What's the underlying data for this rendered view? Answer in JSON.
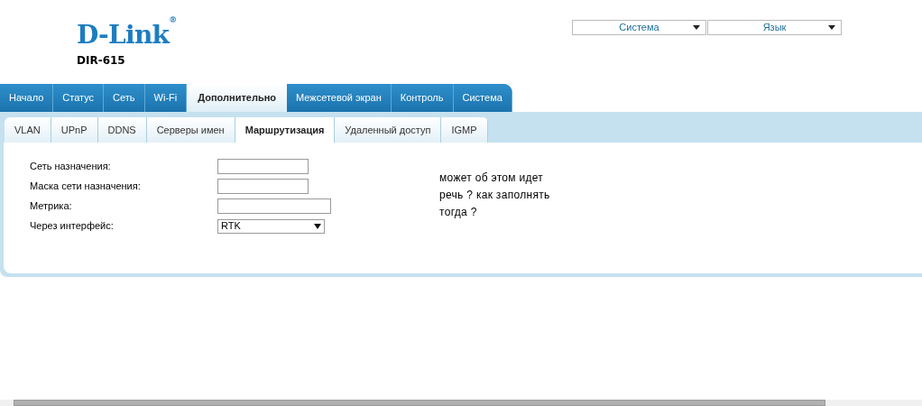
{
  "header": {
    "logo": "D-Link$^{®}$",
    "model": "DIR-615",
    "menus": [
      {
        "label": "Система"
      },
      {
        "label": "Язык"
      }
    ]
  },
  "main_tabs": [
    {
      "label": "Начало",
      "selected": false
    },
    {
      "label": "Статус",
      "selected": false
    },
    {
      "label": "Сеть",
      "selected": false
    },
    {
      "label": "Wi-Fi",
      "selected": false
    },
    {
      "label": "Дополнительно",
      "selected": true
    },
    {
      "label": "Межсетевой экран",
      "selected": false
    },
    {
      "label": "Контроль",
      "selected": false
    },
    {
      "label": "Система",
      "selected": false
    }
  ],
  "sub_tabs": [
    {
      "label": "VLAN",
      "selected": false
    },
    {
      "label": "UPnP",
      "selected": false
    },
    {
      "label": "DDNS",
      "selected": false
    },
    {
      "label": "Серверы имен",
      "selected": false
    },
    {
      "label": "Маршрутизация",
      "selected": true
    },
    {
      "label": "Удаленный доступ",
      "selected": false
    },
    {
      "label": "IGMP",
      "selected": false
    }
  ],
  "form": [
    {
      "kind": "text",
      "label": "Сеть назначения:",
      "wide": false
    },
    {
      "kind": "text",
      "label": "Маска сети назначения:",
      "wide": false
    },
    {
      "kind": "text",
      "label": "Метрика:",
      "wide": true
    },
    {
      "kind": "select",
      "label": "Через интерфейс:",
      "value": "RTK"
    }
  ],
  "note": [
    "может об этом идет",
    "речь ? как заполнять",
    "тогда ?"
  ]
}
